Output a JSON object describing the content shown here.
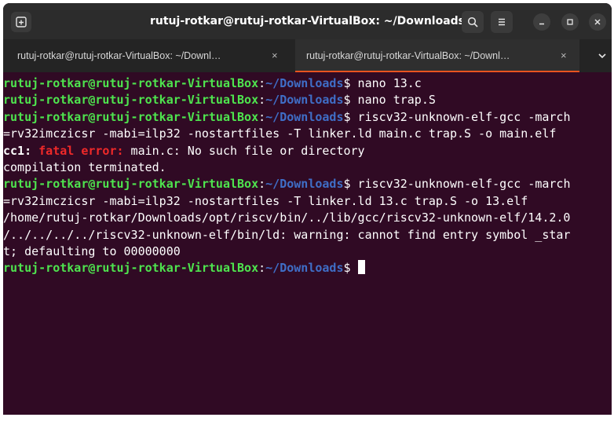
{
  "window": {
    "title": "rutuj-rotkar@rutuj-rotkar-VirtualBox: ~/Downloads"
  },
  "header": {
    "new_tab_icon": "new-tab-icon",
    "search_icon": "search-icon",
    "menu_icon": "hamburger-menu-icon",
    "minimize_icon": "minimize-icon",
    "maximize_icon": "maximize-icon",
    "close_icon": "close-icon"
  },
  "tabs": [
    {
      "label": "rutuj-rotkar@rutuj-rotkar-VirtualBox: ~/Downl…",
      "close": "×",
      "active": false
    },
    {
      "label": "rutuj-rotkar@rutuj-rotkar-VirtualBox: ~/Downl…",
      "close": "×",
      "active": true
    }
  ],
  "prompt": {
    "user": "rutuj-rotkar@rutuj-rotkar-VirtualBox",
    "colon": ":",
    "path": "~/Downloads",
    "symbol": "$"
  },
  "terminal": {
    "cmd1": " nano 13.c",
    "cmd2": " nano trap.S",
    "cmd3": " riscv32-unknown-elf-gcc -march",
    "cmd3_cont": "=rv32imczicsr -mabi=ilp32 -nostartfiles -T linker.ld main.c trap.S -o main.elf",
    "err_prefix": "cc1:",
    "err_fatal": " fatal error:",
    "err_msg": " main.c: No such file or directory",
    "compilation": "compilation terminated.",
    "cmd4": " riscv32-unknown-elf-gcc -march",
    "cmd4_cont": "=rv32imczicsr -mabi=ilp32 -nostartfiles -T linker.ld 13.c trap.S -o 13.elf",
    "warn1": "/home/rutuj-rotkar/Downloads/opt/riscv/bin/../lib/gcc/riscv32-unknown-elf/14.2.0",
    "warn2": "/../../../../riscv32-unknown-elf/bin/ld: warning: cannot find entry symbol _star",
    "warn3": "t; defaulting to 00000000",
    "last": " "
  },
  "colors": {
    "background": "#300a24",
    "prompt_user": "#4ee44e",
    "prompt_path": "#3f6ec7",
    "error": "#ef2929",
    "tab_accent": "#e95420"
  }
}
